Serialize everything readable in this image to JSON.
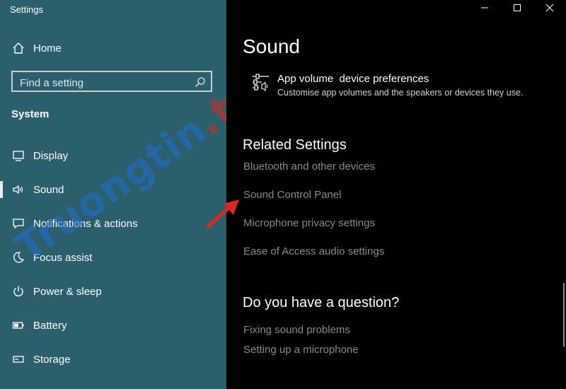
{
  "window": {
    "app_title": "Settings",
    "controls": [
      "minimize",
      "maximize",
      "close"
    ]
  },
  "sidebar": {
    "home_label": "Home",
    "search_placeholder": "Find a setting",
    "section_title": "System",
    "items": [
      {
        "label": "Display",
        "icon": "display-icon"
      },
      {
        "label": "Sound",
        "icon": "speaker-icon",
        "active": true
      },
      {
        "label": "Notifications & actions",
        "icon": "notification-icon"
      },
      {
        "label": "Focus assist",
        "icon": "moon-icon"
      },
      {
        "label": "Power & sleep",
        "icon": "power-icon"
      },
      {
        "label": "Battery",
        "icon": "battery-icon"
      },
      {
        "label": "Storage",
        "icon": "storage-icon"
      }
    ]
  },
  "main": {
    "title": "Sound",
    "app_volume": {
      "title": "App volume  device preferences",
      "subtitle": "Customise app volumes and the speakers or devices they use."
    },
    "related_title": "Related Settings",
    "related_links": [
      "Bluetooth and other devices",
      "Sound Control Panel",
      "Microphone privacy settings",
      "Ease of Access audio settings"
    ],
    "question_title": "Do you have a question?",
    "help_links": [
      "Fixing sound problems",
      "Setting up a microphone"
    ]
  },
  "watermark": {
    "part1": "Truongtin",
    "part2": ".top"
  },
  "colors": {
    "sidebar_bg": "#2b5f6b",
    "main_bg": "#000000",
    "link_gray": "#8a8a8a",
    "arrow_red": "#e2261c"
  }
}
